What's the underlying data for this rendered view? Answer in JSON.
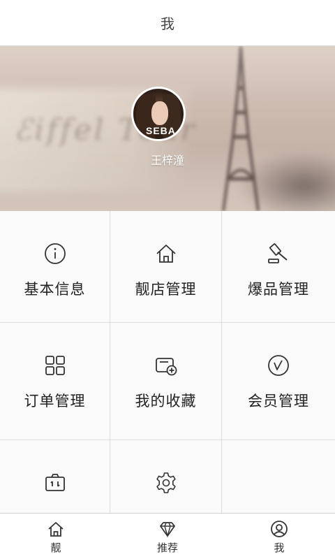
{
  "header": {
    "title": "我"
  },
  "profile": {
    "username": "王梓潼",
    "avatar_logo_text": "SEBA"
  },
  "menu": {
    "items": [
      {
        "label": "基本信息",
        "icon": "info-icon"
      },
      {
        "label": "靓店管理",
        "icon": "home-icon"
      },
      {
        "label": "爆品管理",
        "icon": "gavel-icon"
      },
      {
        "label": "订单管理",
        "icon": "grid-icon"
      },
      {
        "label": "我的收藏",
        "icon": "wallet-add-icon"
      },
      {
        "label": "会员管理",
        "icon": "check-circle-icon"
      },
      {
        "label": "",
        "icon": "camera-switch-icon"
      },
      {
        "label": "",
        "icon": "gear-icon"
      }
    ]
  },
  "tabbar": {
    "items": [
      {
        "label": "靓",
        "icon": "home-icon"
      },
      {
        "label": "推荐",
        "icon": "diamond-icon"
      },
      {
        "label": "我",
        "icon": "user-icon"
      }
    ]
  },
  "colors": {
    "icon_stroke": "#333333",
    "divider": "#dedede",
    "background": "#fafafa"
  }
}
